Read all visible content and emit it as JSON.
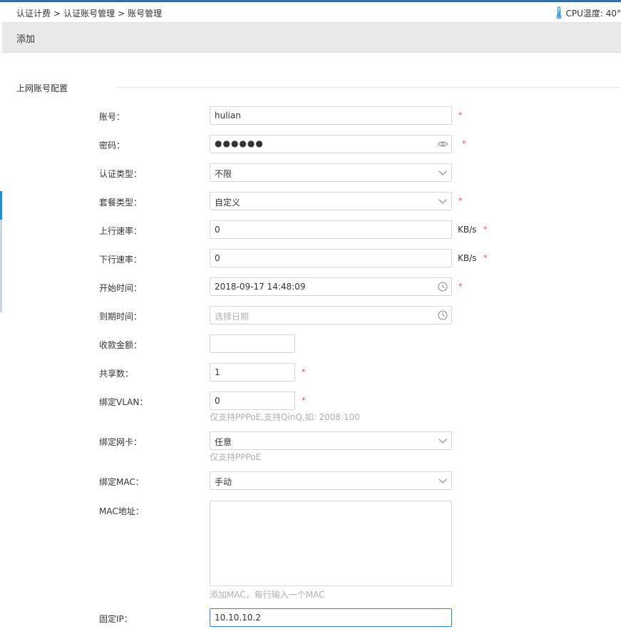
{
  "breadcrumb": {
    "items": [
      "认证计费",
      "认证账号管理",
      "账号管理"
    ],
    "separator": ">"
  },
  "cpu": {
    "label": "CPU温度: 40°"
  },
  "page": {
    "title": "添加"
  },
  "section": {
    "title": "上网账号配置"
  },
  "form": {
    "account": {
      "label": "账号：",
      "value": "hulian",
      "required": "*"
    },
    "password": {
      "label": "密码：",
      "value": "●●●●●●",
      "required": "*"
    },
    "auth_type": {
      "label": "认证类型：",
      "value": "不限"
    },
    "package": {
      "label": "套餐类型：",
      "value": "自定义",
      "required": "*"
    },
    "up_rate": {
      "label": "上行速率：",
      "value": "0",
      "unit": "KB/s",
      "required": "*"
    },
    "down_rate": {
      "label": "下行速率：",
      "value": "0",
      "unit": "KB/s",
      "required": "*"
    },
    "start_time": {
      "label": "开始时间：",
      "value": "2018-09-17 14:48:09",
      "required": "*"
    },
    "end_time": {
      "label": "到期时间：",
      "placeholder": "选择日期"
    },
    "amount": {
      "label": "收款金额：",
      "value": ""
    },
    "shares": {
      "label": "共享数：",
      "value": "1",
      "required": "*"
    },
    "vlan": {
      "label": "绑定VLAN：",
      "value": "0",
      "required": "*",
      "hint": "仅支持PPPoE,支持QinQ,如: 2008.100"
    },
    "nic": {
      "label": "绑定网卡：",
      "value": "任意",
      "hint": "仅支持PPPoE"
    },
    "bind_mac": {
      "label": "绑定MAC：",
      "value": "手动"
    },
    "mac_address": {
      "label": "MAC地址：",
      "value": "",
      "hint": "添加MAC，每行输入一个MAC"
    },
    "fixed_ip": {
      "label": "固定IP：",
      "value": "10.10.10.2"
    }
  },
  "icons": {
    "thermometer": "thermometer-icon",
    "eye": "eye-icon",
    "chevron": "chevron-down-icon",
    "clock": "clock-icon"
  },
  "colors": {
    "accent": "#2a86c8",
    "required": "#e94b4b",
    "titlebar": "#e9e9e9"
  }
}
